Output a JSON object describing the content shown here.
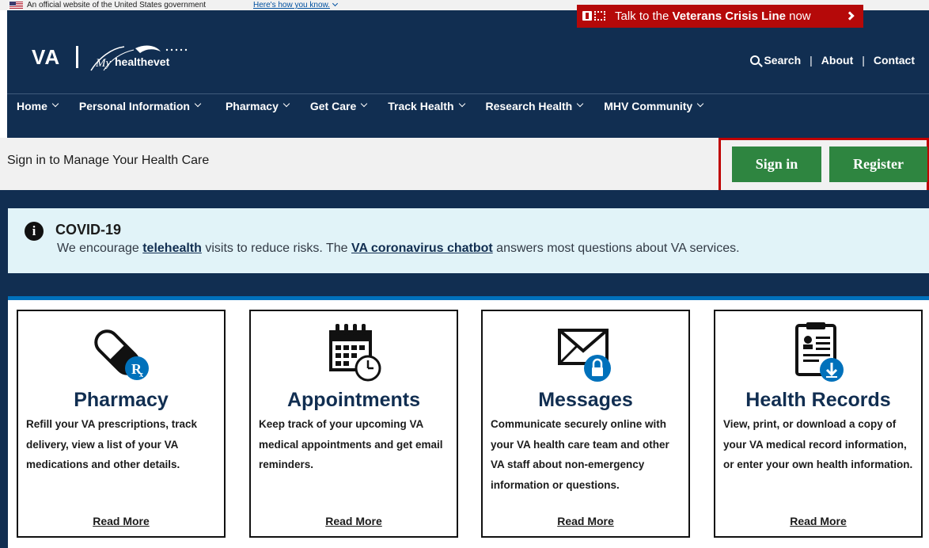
{
  "gov_banner": {
    "official_text": "An official website of the United States government",
    "how_you_know": "Here's how you know."
  },
  "crisis_line": {
    "prefix": "Talk to the ",
    "bold": "Veterans Crisis Line",
    "suffix": " now"
  },
  "header": {
    "logo_va": "VA",
    "logo_mhv": "healthevet",
    "logo_my": "My",
    "links": {
      "search": "Search",
      "about": "About",
      "contact": "Contact"
    }
  },
  "nav": [
    {
      "label": "Home"
    },
    {
      "label": "Personal Information"
    },
    {
      "label": "Pharmacy"
    },
    {
      "label": "Get Care"
    },
    {
      "label": "Track Health"
    },
    {
      "label": "Research Health"
    },
    {
      "label": "MHV Community"
    }
  ],
  "signin_bar": {
    "title": "Sign in to Manage Your Health Care",
    "signin_label": "Sign in",
    "register_label": "Register"
  },
  "covid": {
    "title": "COVID-19",
    "text_1": "We encourage ",
    "link_1": "telehealth",
    "text_2": " visits to reduce risks. The ",
    "link_2": "VA coronavirus chatbot",
    "text_3": " answers most questions about VA services."
  },
  "cards": [
    {
      "icon": "pill-rx-icon",
      "title": "Pharmacy",
      "description": "Refill your VA prescriptions, track delivery, view a list of your VA medications and other details.",
      "link": "Read More"
    },
    {
      "icon": "calendar-clock-icon",
      "title": "Appointments",
      "description": "Keep track of your upcoming VA medical appointments and get email reminders.",
      "link": "Read More"
    },
    {
      "icon": "envelope-lock-icon",
      "title": "Messages",
      "description": "Communicate securely online with your VA health care team and other VA staff about non-emergency information or questions.",
      "link": "Read More"
    },
    {
      "icon": "record-download-icon",
      "title": "Health Records",
      "description": "View, print, or download a copy of your VA medical record information, or enter your own health information.",
      "link": "Read More"
    }
  ],
  "colors": {
    "navy": "#112e51",
    "crisis_red": "#b50909",
    "button_green": "#2e8540",
    "covid_bg": "#e1f3f8",
    "icon_blue": "#0071bb"
  }
}
